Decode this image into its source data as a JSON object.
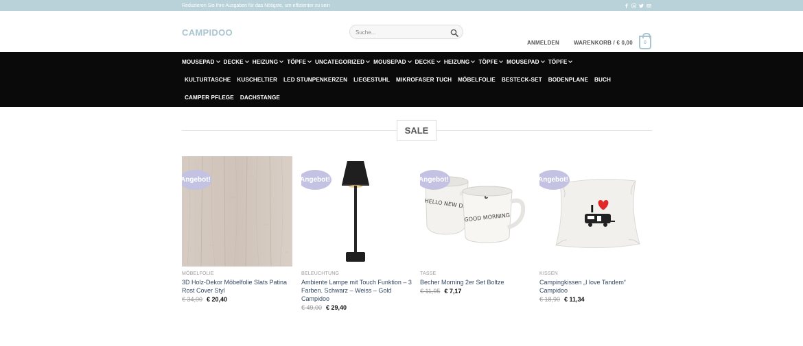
{
  "topbar": {
    "promo": "Reduzieren Sie Ihre Ausgaben für das Nötigste, um effizienter zu sein",
    "socials": [
      "facebook-icon",
      "instagram-icon",
      "twitter-icon",
      "email-icon"
    ]
  },
  "header": {
    "logo": "CAMPIDOO",
    "search_placeholder": "Suche...",
    "login": "ANMELDEN",
    "cart": "WARENKORB / € 0,00",
    "cart_count": "0"
  },
  "nav": {
    "row1": [
      "MOUSEPAD",
      "DECKE",
      "HEIZUNG",
      "TÖPFE",
      "UNCATEGORIZED",
      "MOUSEPAD",
      "DECKE",
      "HEIZUNG",
      "TÖPFE",
      "MOUSEPAD",
      "TÖPFE"
    ],
    "row2": [
      "KULTURTASCHE",
      "KUSCHELTIER",
      "LED STUNPENKERZEN",
      "LIEGESTUHL",
      "MIKROFASER TUCH",
      "MÖBELFOLIE",
      "BESTECK-SET",
      "BODENPLANE",
      "BUCH"
    ],
    "row3": [
      "CAMPER PFLEGE",
      "DACHSTANGE"
    ]
  },
  "section": {
    "title": "SALE"
  },
  "products": [
    {
      "badge": "Angebot!",
      "category": "MÖBELFOLIE",
      "title": "3D Holz-Dekor Möbelfolie Slats Patina Rost Cover Styl",
      "old_price": "€ 34,00",
      "new_price": "€ 20,40"
    },
    {
      "badge": "Angebot!",
      "category": "BELEUCHTUNG",
      "title": "Ambiente Lampe mit Touch Funktion – 3 Farben. Schwarz – Weiss – Gold Campidoo",
      "old_price": "€ 49,00",
      "new_price": "€ 29,40"
    },
    {
      "badge": "Angebot!",
      "category": "TASSE",
      "title": "Becher Morning 2er Set Boltze",
      "old_price": "€ 11,95",
      "new_price": "€ 7,17"
    },
    {
      "badge": "Angebot!",
      "category": "KISSEN",
      "title": "Campingkissen „I love Tandem“ Campidoo",
      "old_price": "€ 18,90",
      "new_price": "€ 11,34"
    }
  ],
  "mug_text": {
    "left": "HELLO NEW DAY",
    "right": "GOOD MORNING"
  },
  "pillow_text": "I"
}
